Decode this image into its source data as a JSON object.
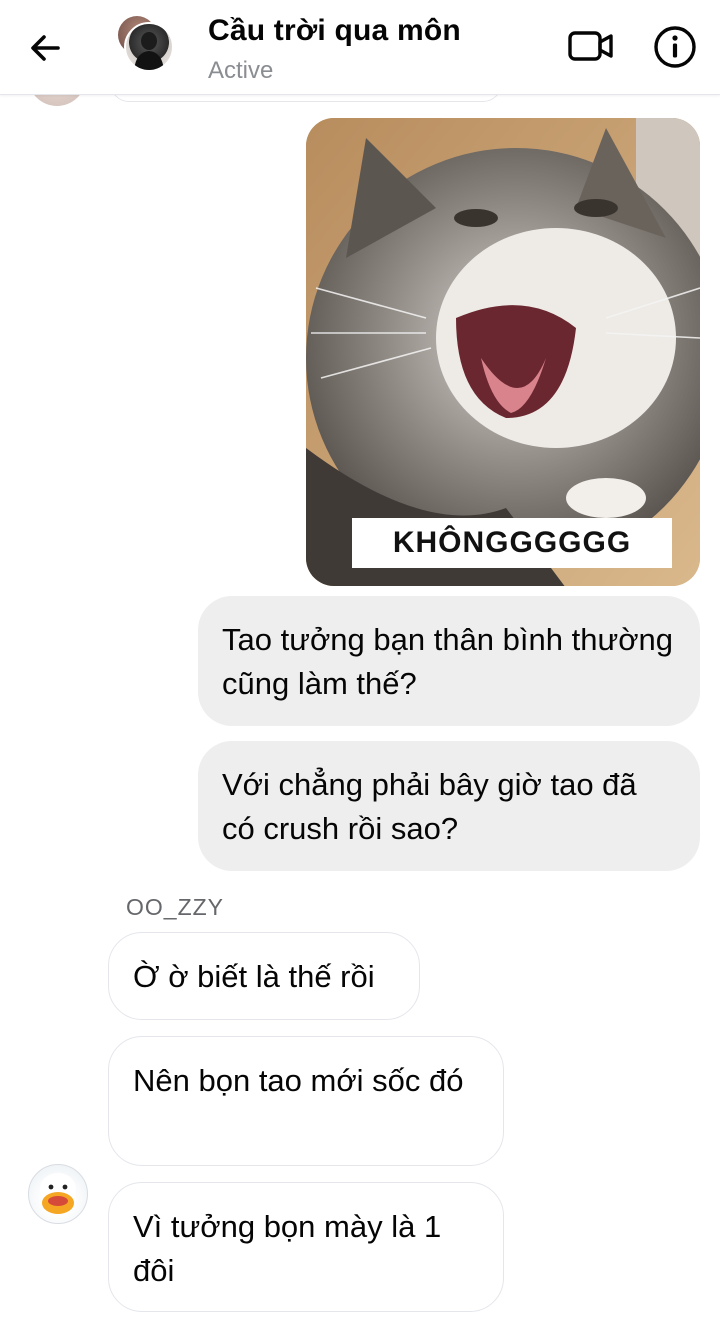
{
  "header": {
    "title": "Cầu trời qua môn",
    "status": "Active"
  },
  "messages": {
    "image_caption": "KHÔNGGGGGG",
    "out_1": "Tao tưởng bạn thân bình thường cũng làm thế?",
    "out_2": "Với chẳng phải bây giờ tao đã có crush rồi sao?",
    "sender_name": "OO_ZZY",
    "in_1": "Ờ ờ biết là thế rồi",
    "in_2": "Nên bọn tao mới sốc đó",
    "in_3": "Vì tưởng bọn mày là 1 đôi"
  },
  "icons": {
    "back": "arrow-left-icon",
    "video": "video-camera-icon",
    "info": "info-icon"
  },
  "colors": {
    "outgoing_bubble": "#eeeeee",
    "incoming_border": "#e4e6eb",
    "secondary_text": "#8a8d91"
  }
}
